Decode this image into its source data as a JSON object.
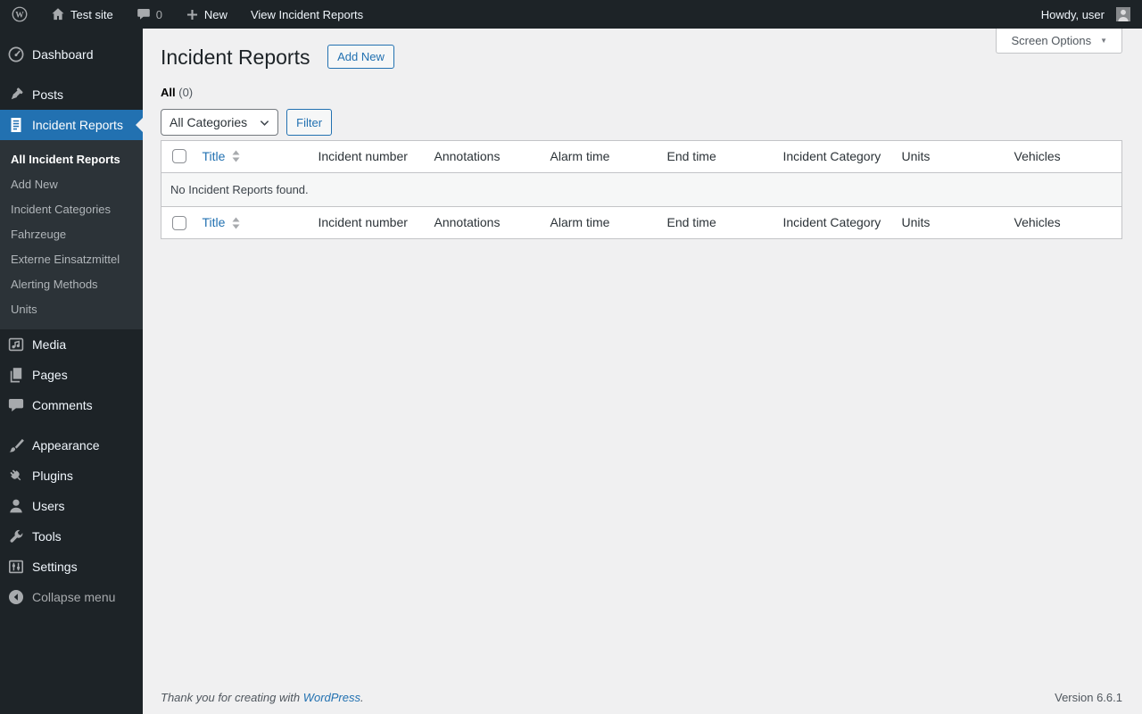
{
  "admin_bar": {
    "site_name": "Test site",
    "comments_count": "0",
    "new_label": "New",
    "view_label": "View Incident Reports",
    "howdy": "Howdy, user"
  },
  "sidebar": {
    "items": [
      {
        "label": "Dashboard",
        "icon": "dashboard-icon"
      },
      {
        "label": "Posts",
        "icon": "pin-icon"
      },
      {
        "label": "Incident Reports",
        "icon": "document-icon",
        "active": true
      },
      {
        "label": "Media",
        "icon": "media-icon"
      },
      {
        "label": "Pages",
        "icon": "pages-icon"
      },
      {
        "label": "Comments",
        "icon": "comment-icon"
      },
      {
        "label": "Appearance",
        "icon": "brush-icon"
      },
      {
        "label": "Plugins",
        "icon": "plugin-icon"
      },
      {
        "label": "Users",
        "icon": "user-icon"
      },
      {
        "label": "Tools",
        "icon": "wrench-icon"
      },
      {
        "label": "Settings",
        "icon": "settings-icon"
      }
    ],
    "submenu": [
      "All Incident Reports",
      "Add New",
      "Incident Categories",
      "Fahrzeuge",
      "Externe Einsatzmittel",
      "Alerting Methods",
      "Units"
    ],
    "collapse_label": "Collapse menu"
  },
  "main": {
    "title": "Incident Reports",
    "add_new_label": "Add New",
    "screen_options_label": "Screen Options",
    "filters": {
      "all_label": "All",
      "all_count": "(0)"
    },
    "categories_select_value": "All Categories",
    "filter_button_label": "Filter",
    "table": {
      "columns": [
        "Title",
        "Incident number",
        "Annotations",
        "Alarm time",
        "End time",
        "Incident Category",
        "Units",
        "Vehicles"
      ],
      "empty_message": "No Incident Reports found."
    }
  },
  "footer": {
    "thanks_prefix": "Thank you for creating with ",
    "wordpress_link": "WordPress",
    "thanks_suffix": ".",
    "version": "Version 6.6.1"
  },
  "colors": {
    "accent": "#2271b1",
    "adminbar_bg": "#1d2327",
    "submenu_bg": "#2c3338",
    "content_bg": "#f0f0f1",
    "border": "#c3c4c7"
  }
}
